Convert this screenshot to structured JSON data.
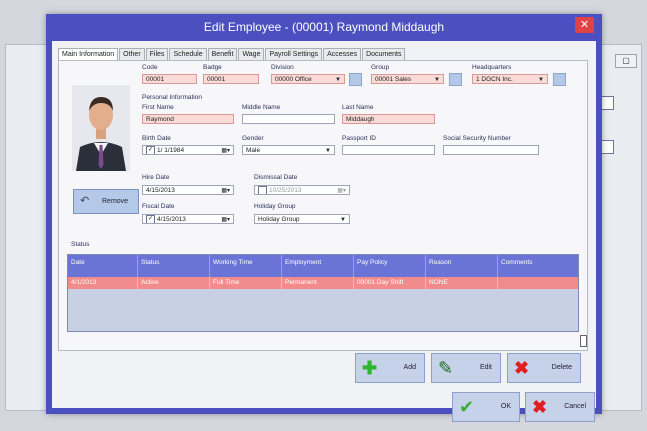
{
  "dialog": {
    "title": "Edit Employee - (00001) Raymond Middaugh"
  },
  "tabs": [
    "Main Information",
    "Other",
    "Files",
    "Schedule",
    "Benefit",
    "Wage",
    "Payroll Settings",
    "Accesses",
    "Documents"
  ],
  "top": {
    "code_label": "Code",
    "code_value": "00001",
    "badge_label": "Badge",
    "badge_value": "00001",
    "division_label": "Division",
    "division_value": "00000  Office",
    "group_label": "Group",
    "group_value": "00001  Sales",
    "hq_label": "Headquarters",
    "hq_value": "1  DGCN Inc."
  },
  "personal": {
    "section_label": "Personal Information",
    "first_name_label": "First Name",
    "first_name_value": "Raymond",
    "middle_name_label": "Middle Name",
    "middle_name_value": "",
    "last_name_label": "Last Name",
    "last_name_value": "Middaugh",
    "birth_date_label": "Birth Date",
    "birth_date_value": "1/ 1/1984",
    "gender_label": "Gender",
    "gender_value": "Male",
    "passport_label": "Passport ID",
    "passport_value": "",
    "ssn_label": "Social Security Number",
    "ssn_value": ""
  },
  "remove_label": "Remove",
  "dates": {
    "hire_label": "Hire Date",
    "hire_value": "4/15/2013",
    "dismissal_label": "Dismissal Date",
    "dismissal_value": "10/25/2013",
    "fiscal_label": "Fiscal Date",
    "fiscal_value": "4/15/2013",
    "holiday_label": "Holiday Group",
    "holiday_value": "Holiday Group"
  },
  "status": {
    "label": "Status",
    "columns": [
      "Date",
      "Status",
      "Working Time",
      "Employment",
      "Pay Policy",
      "Reason",
      "Comments"
    ],
    "rows": [
      [
        "4/1/2013",
        "Active",
        "Full Time",
        "Permanent",
        "00001  Day Shift",
        "NONE",
        ""
      ]
    ]
  },
  "actions": {
    "add": "Add",
    "edit": "Edit",
    "delete": "Delete",
    "ok": "OK",
    "cancel": "Cancel"
  },
  "colors": {
    "title_bar": "#4b4fbf",
    "grid_header": "#6a73d6",
    "selected_row": "#f28b8b",
    "close": "#e04343"
  }
}
